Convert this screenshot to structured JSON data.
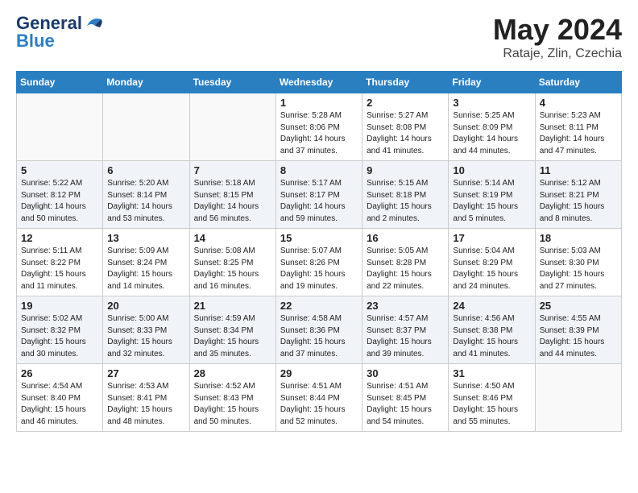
{
  "logo": {
    "line1": "General",
    "line2": "Blue"
  },
  "title": "May 2024",
  "subtitle": "Rataje, Zlin, Czechia",
  "days_of_week": [
    "Sunday",
    "Monday",
    "Tuesday",
    "Wednesday",
    "Thursday",
    "Friday",
    "Saturday"
  ],
  "weeks": [
    [
      {
        "day": "",
        "info": ""
      },
      {
        "day": "",
        "info": ""
      },
      {
        "day": "",
        "info": ""
      },
      {
        "day": "1",
        "info": "Sunrise: 5:28 AM\nSunset: 8:06 PM\nDaylight: 14 hours\nand 37 minutes."
      },
      {
        "day": "2",
        "info": "Sunrise: 5:27 AM\nSunset: 8:08 PM\nDaylight: 14 hours\nand 41 minutes."
      },
      {
        "day": "3",
        "info": "Sunrise: 5:25 AM\nSunset: 8:09 PM\nDaylight: 14 hours\nand 44 minutes."
      },
      {
        "day": "4",
        "info": "Sunrise: 5:23 AM\nSunset: 8:11 PM\nDaylight: 14 hours\nand 47 minutes."
      }
    ],
    [
      {
        "day": "5",
        "info": "Sunrise: 5:22 AM\nSunset: 8:12 PM\nDaylight: 14 hours\nand 50 minutes."
      },
      {
        "day": "6",
        "info": "Sunrise: 5:20 AM\nSunset: 8:14 PM\nDaylight: 14 hours\nand 53 minutes."
      },
      {
        "day": "7",
        "info": "Sunrise: 5:18 AM\nSunset: 8:15 PM\nDaylight: 14 hours\nand 56 minutes."
      },
      {
        "day": "8",
        "info": "Sunrise: 5:17 AM\nSunset: 8:17 PM\nDaylight: 14 hours\nand 59 minutes."
      },
      {
        "day": "9",
        "info": "Sunrise: 5:15 AM\nSunset: 8:18 PM\nDaylight: 15 hours\nand 2 minutes."
      },
      {
        "day": "10",
        "info": "Sunrise: 5:14 AM\nSunset: 8:19 PM\nDaylight: 15 hours\nand 5 minutes."
      },
      {
        "day": "11",
        "info": "Sunrise: 5:12 AM\nSunset: 8:21 PM\nDaylight: 15 hours\nand 8 minutes."
      }
    ],
    [
      {
        "day": "12",
        "info": "Sunrise: 5:11 AM\nSunset: 8:22 PM\nDaylight: 15 hours\nand 11 minutes."
      },
      {
        "day": "13",
        "info": "Sunrise: 5:09 AM\nSunset: 8:24 PM\nDaylight: 15 hours\nand 14 minutes."
      },
      {
        "day": "14",
        "info": "Sunrise: 5:08 AM\nSunset: 8:25 PM\nDaylight: 15 hours\nand 16 minutes."
      },
      {
        "day": "15",
        "info": "Sunrise: 5:07 AM\nSunset: 8:26 PM\nDaylight: 15 hours\nand 19 minutes."
      },
      {
        "day": "16",
        "info": "Sunrise: 5:05 AM\nSunset: 8:28 PM\nDaylight: 15 hours\nand 22 minutes."
      },
      {
        "day": "17",
        "info": "Sunrise: 5:04 AM\nSunset: 8:29 PM\nDaylight: 15 hours\nand 24 minutes."
      },
      {
        "day": "18",
        "info": "Sunrise: 5:03 AM\nSunset: 8:30 PM\nDaylight: 15 hours\nand 27 minutes."
      }
    ],
    [
      {
        "day": "19",
        "info": "Sunrise: 5:02 AM\nSunset: 8:32 PM\nDaylight: 15 hours\nand 30 minutes."
      },
      {
        "day": "20",
        "info": "Sunrise: 5:00 AM\nSunset: 8:33 PM\nDaylight: 15 hours\nand 32 minutes."
      },
      {
        "day": "21",
        "info": "Sunrise: 4:59 AM\nSunset: 8:34 PM\nDaylight: 15 hours\nand 35 minutes."
      },
      {
        "day": "22",
        "info": "Sunrise: 4:58 AM\nSunset: 8:36 PM\nDaylight: 15 hours\nand 37 minutes."
      },
      {
        "day": "23",
        "info": "Sunrise: 4:57 AM\nSunset: 8:37 PM\nDaylight: 15 hours\nand 39 minutes."
      },
      {
        "day": "24",
        "info": "Sunrise: 4:56 AM\nSunset: 8:38 PM\nDaylight: 15 hours\nand 41 minutes."
      },
      {
        "day": "25",
        "info": "Sunrise: 4:55 AM\nSunset: 8:39 PM\nDaylight: 15 hours\nand 44 minutes."
      }
    ],
    [
      {
        "day": "26",
        "info": "Sunrise: 4:54 AM\nSunset: 8:40 PM\nDaylight: 15 hours\nand 46 minutes."
      },
      {
        "day": "27",
        "info": "Sunrise: 4:53 AM\nSunset: 8:41 PM\nDaylight: 15 hours\nand 48 minutes."
      },
      {
        "day": "28",
        "info": "Sunrise: 4:52 AM\nSunset: 8:43 PM\nDaylight: 15 hours\nand 50 minutes."
      },
      {
        "day": "29",
        "info": "Sunrise: 4:51 AM\nSunset: 8:44 PM\nDaylight: 15 hours\nand 52 minutes."
      },
      {
        "day": "30",
        "info": "Sunrise: 4:51 AM\nSunset: 8:45 PM\nDaylight: 15 hours\nand 54 minutes."
      },
      {
        "day": "31",
        "info": "Sunrise: 4:50 AM\nSunset: 8:46 PM\nDaylight: 15 hours\nand 55 minutes."
      },
      {
        "day": "",
        "info": ""
      }
    ]
  ]
}
